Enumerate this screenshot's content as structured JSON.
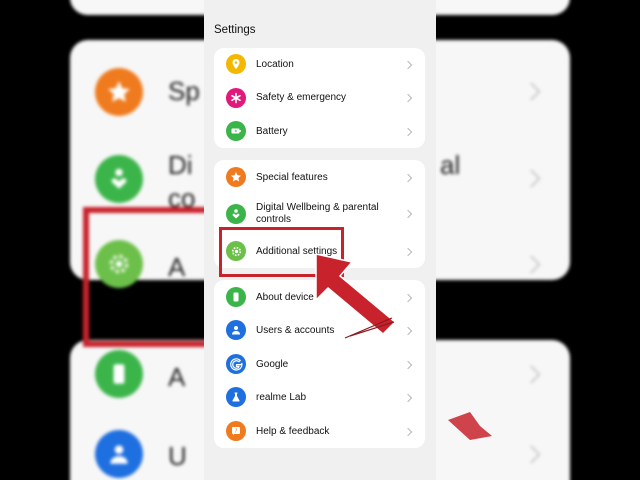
{
  "settings_title": "Settings",
  "groups": [
    {
      "items": [
        {
          "label": "Location",
          "icon": "location-icon",
          "color": "#f5b800"
        },
        {
          "label": "Safety & emergency",
          "icon": "asterisk-icon",
          "color": "#e0197a"
        },
        {
          "label": "Battery",
          "icon": "battery-icon",
          "color": "#3bb54a"
        }
      ]
    },
    {
      "items": [
        {
          "label": "Special features",
          "icon": "star-icon",
          "color": "#f07b1e"
        },
        {
          "label": "Digital Wellbeing & parental controls",
          "icon": "heart-person-icon",
          "color": "#3bb54a"
        },
        {
          "label": "Additional settings",
          "icon": "gear-icon",
          "color": "#6cc04a"
        }
      ]
    },
    {
      "items": [
        {
          "label": "About device",
          "icon": "phone-icon",
          "color": "#3bb54a"
        },
        {
          "label": "Users & accounts",
          "icon": "user-icon",
          "color": "#1e6fe0"
        },
        {
          "label": "Google",
          "icon": "google-icon",
          "color": "#1e6fe0"
        },
        {
          "label": "realme Lab",
          "icon": "flask-icon",
          "color": "#1e6fe0"
        },
        {
          "label": "Help & feedback",
          "icon": "help-icon",
          "color": "#f07b1e"
        }
      ]
    }
  ],
  "background_zoom": {
    "items": [
      {
        "text": "Sp",
        "icon": "star-icon",
        "color": "#f07b1e"
      },
      {
        "text": "Di",
        "icon": "heart-person-icon",
        "color": "#3bb54a"
      },
      {
        "text": "co",
        "icon": "",
        "color": ""
      },
      {
        "text": "al",
        "icon": "",
        "color": ""
      },
      {
        "text": "A",
        "icon": "gear-icon",
        "color": "#6cc04a"
      },
      {
        "text": "A",
        "icon": "phone-icon",
        "color": "#3bb54a"
      },
      {
        "text": "U",
        "icon": "user-icon",
        "color": "#1e6fe0"
      }
    ]
  },
  "highlight_color": "#c8232c"
}
